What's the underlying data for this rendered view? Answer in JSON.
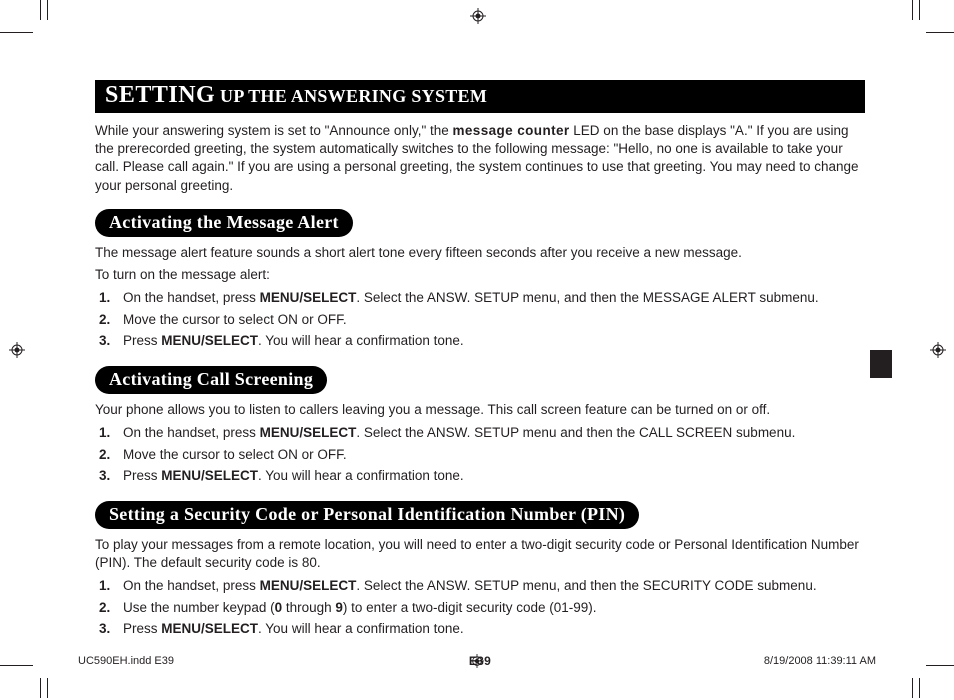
{
  "title": {
    "strong": "SETTING",
    "rest": " UP THE ANSWERING SYSTEM"
  },
  "intro": {
    "p1a": "While your answering system is set to \"Announce only,\" the ",
    "p1b": "message counter",
    "p1c": " LED on the base displays \"A.\" If you are using the prerecorded greeting, the system automatically switches to the following message: \"Hello, no one is available to take your call. Please call again.\" If you are using a personal greeting, the system continues to use that greeting. You may need to change your personal greeting."
  },
  "sections": [
    {
      "heading": "Activating the Message Alert",
      "intro_lines": [
        "The message alert feature sounds a short alert tone every fifteen seconds after you receive a new message.",
        "To turn on the message alert:"
      ],
      "steps": [
        {
          "n": "1.",
          "pre": "On the handset, press ",
          "b1": "MENU/SELECT",
          "post": ". Select the ANSW. SETUP menu, and then the MESSAGE ALERT submenu."
        },
        {
          "n": "2.",
          "pre": "Move the cursor to select ON or OFF.",
          "b1": "",
          "post": ""
        },
        {
          "n": "3.",
          "pre": "Press ",
          "b1": "MENU/SELECT",
          "post": ". You will hear a confirmation tone."
        }
      ]
    },
    {
      "heading": "Activating Call Screening",
      "intro_lines": [
        "Your phone allows you to listen to callers leaving you a message. This call screen feature can be turned on or off."
      ],
      "steps": [
        {
          "n": "1.",
          "pre": "On the handset, press ",
          "b1": "MENU/SELECT",
          "post": ". Select the ANSW. SETUP menu and then the CALL SCREEN submenu."
        },
        {
          "n": "2.",
          "pre": "Move the cursor to select ON or OFF.",
          "b1": "",
          "post": ""
        },
        {
          "n": "3.",
          "pre": "Press ",
          "b1": "MENU/SELECT",
          "post": ". You will hear a confirmation tone."
        }
      ]
    },
    {
      "heading": "Setting a Security Code or Personal Identification Number (PIN)",
      "intro_lines": [
        "To play your messages from a remote location, you will need to enter a two-digit security code or Personal Identification Number (PIN). The default security code is 80."
      ],
      "steps": [
        {
          "n": "1.",
          "pre": "On the handset, press ",
          "b1": "MENU/SELECT",
          "post": ". Select the ANSW. SETUP menu, and then the SECURITY CODE submenu."
        },
        {
          "n": "2.",
          "pre": "Use the number keypad (",
          "b1": "0",
          "mid": " through ",
          "b2": "9",
          "post": ") to enter a two-digit security code (01-99)."
        },
        {
          "n": "3.",
          "pre": "Press ",
          "b1": "MENU/SELECT",
          "post": ". You will hear a confirmation tone."
        }
      ]
    }
  ],
  "page_number": "E39",
  "footer": {
    "file": "UC590EH.indd   E39",
    "datetime": "8/19/2008   11:39:11 AM"
  }
}
